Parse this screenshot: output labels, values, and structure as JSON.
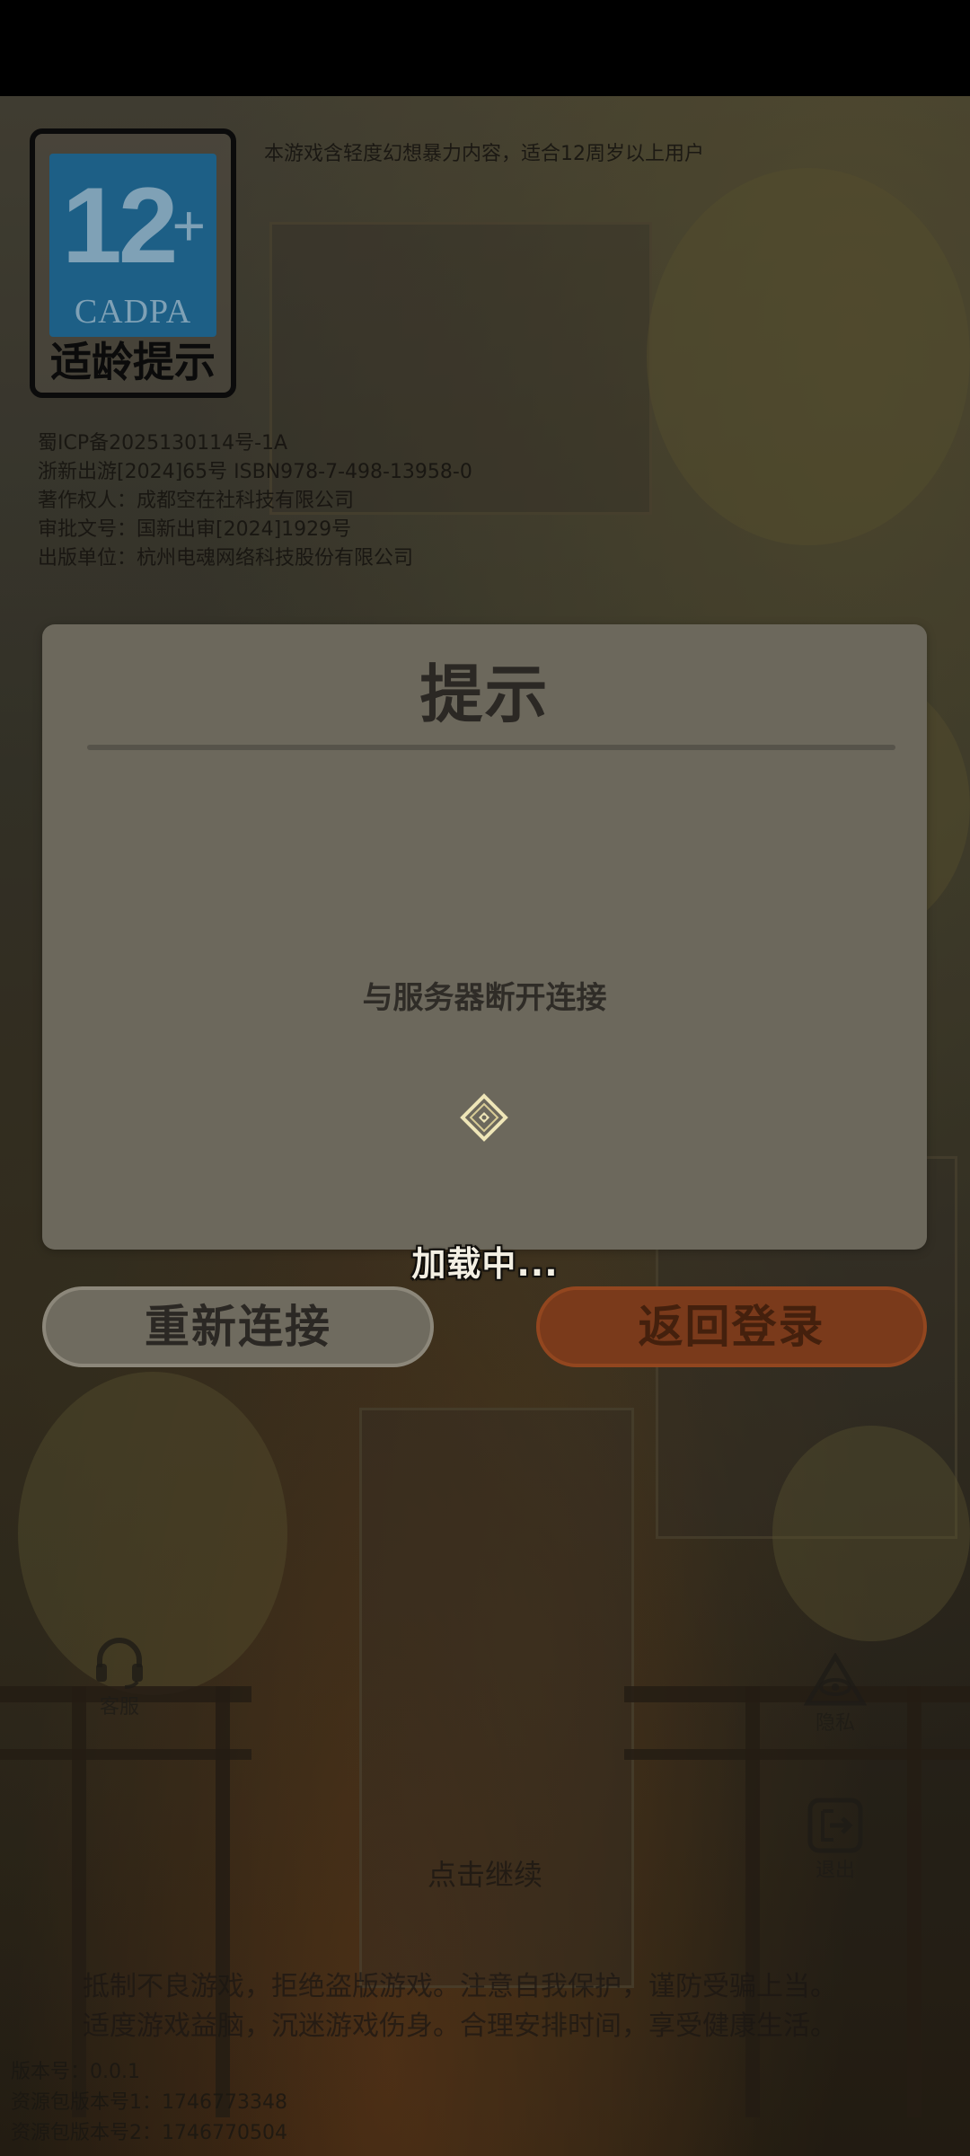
{
  "age_rating": {
    "number": "12",
    "plus": "+",
    "org": "CADPA",
    "label": "适龄提示",
    "description": "本游戏含轻度幻想暴力内容，适合12周岁以上用户"
  },
  "license_lines": [
    "蜀ICP备2025130114号-1A",
    "浙新出游[2024]65号 ISBN978-7-498-13958-0",
    "著作权人：成都空在社科技有限公司",
    "审批文号：国新出审[2024]1929号",
    "出版单位：杭州电魂网络科技股份有限公司"
  ],
  "dialog": {
    "title": "提示",
    "message": "与服务器断开连接"
  },
  "loading_text": "加载中...",
  "buttons": {
    "reconnect": "重新连接",
    "back_to_login": "返回登录"
  },
  "side_icons": {
    "support": {
      "label": "客服",
      "icon": "headset-icon"
    },
    "privacy": {
      "label": "隐私",
      "icon": "eye-triangle-icon"
    },
    "exit": {
      "label": "退出",
      "icon": "exit-icon"
    }
  },
  "tap_to_continue": "点击继续",
  "health_notice": [
    "抵制不良游戏，拒绝盗版游戏。注意自我保护，谨防受骗上当。",
    "适度游戏益脑，沉迷游戏伤身。合理安排时间，享受健康生活。"
  ],
  "version_lines": [
    "版本号：0.0.1",
    "资源包版本号1：1746773348",
    "资源包版本号2：1746770504"
  ],
  "colors": {
    "dialog_bg": "#6c685c",
    "reconnect_button": "#6f6b5f",
    "back_button": "#7a3a1b",
    "rating_blue": "#1d5f86"
  }
}
